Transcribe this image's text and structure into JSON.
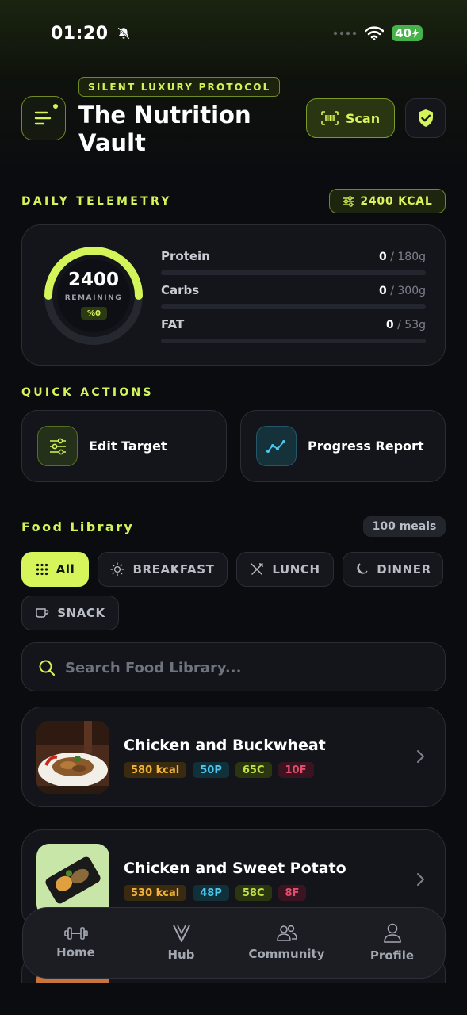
{
  "status_bar": {
    "time": "01:20",
    "battery": "40"
  },
  "header": {
    "badge": "SILENT LUXURY PROTOCOL",
    "title": "The Nutrition Vault",
    "scan_label": "Scan"
  },
  "telemetry": {
    "section_label": "DAILY TELEMETRY",
    "kcal_pill": "2400 KCAL",
    "remaining_value": "2400",
    "remaining_label": "REMAINING",
    "percent": "%0",
    "macros": [
      {
        "name": "Protein",
        "value": "0",
        "target": " / 180g",
        "progress": 0
      },
      {
        "name": "Carbs",
        "value": "0",
        "target": " / 300g",
        "progress": 0
      },
      {
        "name": "FAT",
        "value": "0",
        "target": " / 53g",
        "progress": 0
      }
    ]
  },
  "quick_actions": {
    "section_label": "QUICK ACTIONS",
    "items": [
      {
        "label": "Edit Target",
        "icon": "sliders-icon"
      },
      {
        "label": "Progress Report",
        "icon": "trend-chart-icon"
      }
    ]
  },
  "food_library": {
    "title": "Food Library",
    "count": "100 meals",
    "chips": [
      {
        "label": "All",
        "icon": "grid-icon",
        "active": true
      },
      {
        "label": "BREAKFAST",
        "icon": "sun-icon",
        "active": false
      },
      {
        "label": "LUNCH",
        "icon": "utensils-icon",
        "active": false
      },
      {
        "label": "DINNER",
        "icon": "moon-icon",
        "active": false
      },
      {
        "label": "SNACK",
        "icon": "cup-icon",
        "active": false
      }
    ],
    "search_placeholder": "Search Food Library...",
    "meals": [
      {
        "name": "Chicken and Buckwheat",
        "kcal": "580 kcal",
        "protein": "50P",
        "carbs": "65C",
        "fat": "10F"
      },
      {
        "name": "Chicken and Sweet Potato",
        "kcal": "530 kcal",
        "protein": "48P",
        "carbs": "58C",
        "fat": "8F"
      }
    ]
  },
  "bottom_nav": [
    {
      "label": "Home",
      "icon": "dumbbell-icon"
    },
    {
      "label": "Hub",
      "icon": "hub-v-icon"
    },
    {
      "label": "Community",
      "icon": "users-icon"
    },
    {
      "label": "Profile",
      "icon": "user-icon"
    }
  ],
  "colors": {
    "accent": "#d4f55a",
    "background": "#0b0c10",
    "card": "#13151b",
    "protein": "#4cc6ea",
    "kcal": "#f2b338",
    "fat": "#e24e6c"
  }
}
